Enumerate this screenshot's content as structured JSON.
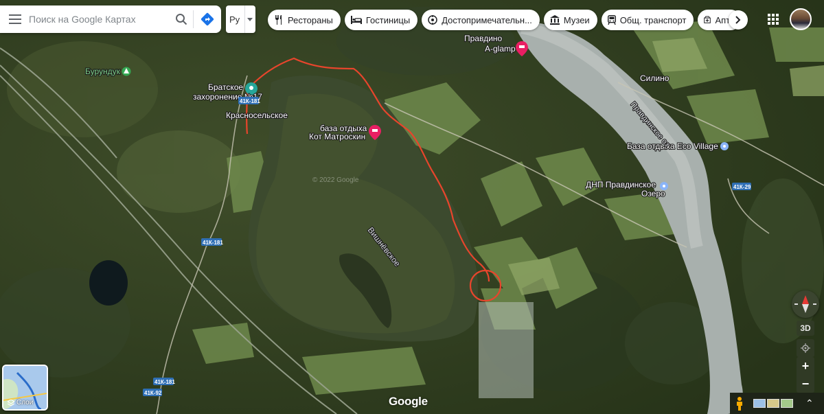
{
  "search": {
    "placeholder": "Поиск на Google Картах",
    "menu_icon": "hamburger-icon",
    "search_icon": "search-icon",
    "directions_icon": "directions-icon"
  },
  "language": {
    "label": "Ру"
  },
  "chips": [
    {
      "label": "Рестораны",
      "icon": "restaurant-icon"
    },
    {
      "label": "Гостиницы",
      "icon": "hotel-icon"
    },
    {
      "label": "Достопримечательн...",
      "icon": "attractions-icon"
    },
    {
      "label": "Музеи",
      "icon": "museum-icon"
    },
    {
      "label": "Общ. транспорт",
      "icon": "transit-icon"
    },
    {
      "label": "Аптеки",
      "icon": "pharmacy-icon"
    }
  ],
  "layers": {
    "label": "Слои"
  },
  "controls": {
    "three_d": "3D",
    "zoom_in": "+",
    "zoom_out": "−",
    "expand": "⌃"
  },
  "logo": "Google",
  "watermark": "© 2022 Google",
  "map": {
    "places": {
      "pravdino": "Правдино",
      "aglamp": "A-glamp",
      "burunduk": "Бурундук",
      "bratskoe1": "Братское",
      "bratskoe2": "захоронение №17",
      "krasnoselskoe": "Красносельское",
      "kot1": "база отдыха",
      "kot2": "Кот Матроскин",
      "silino": "Силино",
      "eco": "База отдыха Eco Village",
      "dnp1": "ДНП Правдинское",
      "dnp2": "Озеро",
      "vishnevskoe": "Вишнёвское",
      "pravdinskoe": "Правдинское оз"
    },
    "roads": {
      "r181a": "41К-181",
      "r181b": "41К-181",
      "r181c": "41К-181",
      "r92": "41К-92",
      "r29": "41К-29"
    },
    "colors": {
      "route": "#e8452c",
      "hotel_pin": "#e91e63",
      "memorial_pin": "#26a69a",
      "park_pin": "#34a853",
      "place_pin": "#8ab4f8"
    }
  }
}
